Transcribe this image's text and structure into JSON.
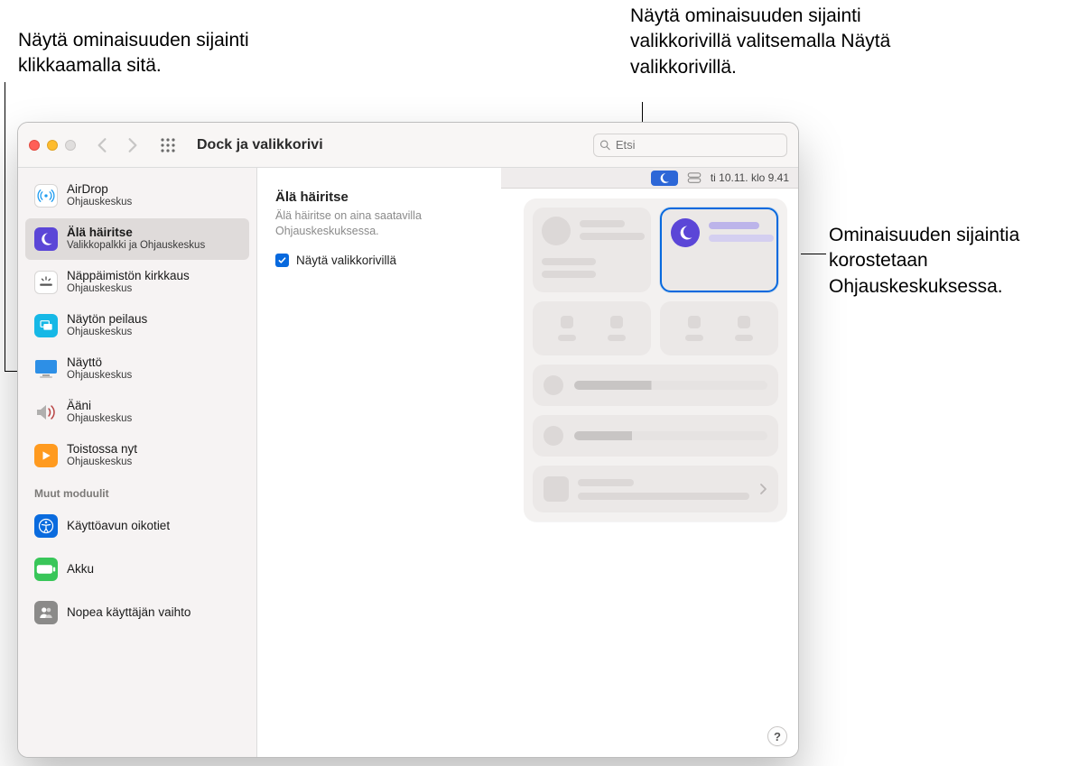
{
  "callouts": {
    "top_left": "Näytä ominaisuuden sijainti klikkaamalla sitä.",
    "top_right": "Näytä ominaisuuden sijainti valikkorivillä valitsemalla Näytä valikkorivillä.",
    "right": "Ominaisuuden sijaintia korostetaan Ohjauskeskuksessa."
  },
  "window": {
    "title": "Dock ja valikkorivi",
    "search_placeholder": "Etsi"
  },
  "sidebar": {
    "items": [
      {
        "title": "AirDrop",
        "sub": "Ohjauskeskus"
      },
      {
        "title": "Älä häiritse",
        "sub": "Valikkopalkki ja Ohjauskeskus"
      },
      {
        "title": "Näppäimistön kirkkaus",
        "sub": "Ohjauskeskus"
      },
      {
        "title": "Näytön peilaus",
        "sub": "Ohjauskeskus"
      },
      {
        "title": "Näyttö",
        "sub": "Ohjauskeskus"
      },
      {
        "title": "Ääni",
        "sub": "Ohjauskeskus"
      },
      {
        "title": "Toistossa nyt",
        "sub": "Ohjauskeskus"
      }
    ],
    "section_header": "Muut moduulit",
    "other_items": [
      {
        "title": "Käyttöavun oikotiet"
      },
      {
        "title": "Akku"
      },
      {
        "title": "Nopea käyttäjän vaihto"
      }
    ]
  },
  "detail": {
    "title": "Älä häiritse",
    "desc": "Älä häiritse on aina saatavilla Ohjauskeskuksessa.",
    "checkbox_label": "Näytä valikkorivillä"
  },
  "menubar": {
    "date_time": "ti 10.11. klo 9.41"
  },
  "help": "?"
}
